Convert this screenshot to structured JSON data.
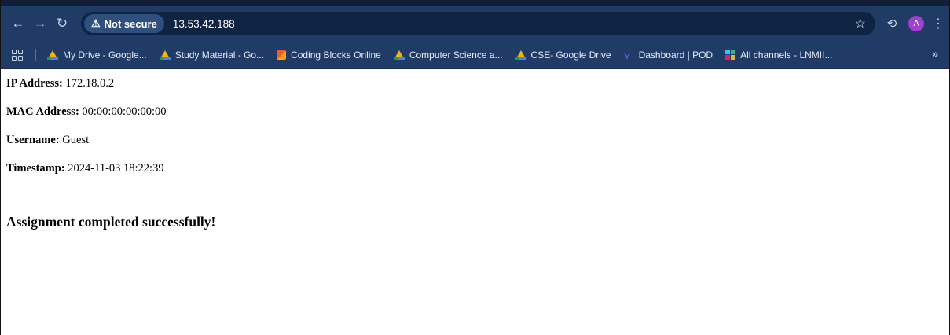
{
  "browser": {
    "security_label": "Not secure",
    "url": "13.53.42.188",
    "profile_initial": "A"
  },
  "bookmarks": [
    {
      "label": "My Drive - Google...",
      "icon": "google-drive-icon"
    },
    {
      "label": "Study Material - Go...",
      "icon": "google-drive-icon"
    },
    {
      "label": "Coding Blocks Online",
      "icon": "coding-blocks-icon"
    },
    {
      "label": "Computer Science a...",
      "icon": "google-drive-icon"
    },
    {
      "label": "CSE- Google Drive",
      "icon": "google-drive-icon"
    },
    {
      "label": "Dashboard | POD",
      "icon": "pod-icon"
    },
    {
      "label": "All channels - LNMII...",
      "icon": "slack-icon"
    }
  ],
  "info": {
    "ip_label": "IP Address:",
    "ip_value": " 172.18.0.2",
    "mac_label": "MAC Address:",
    "mac_value": " 00:00:00:00:00:00",
    "username_label": "Username:",
    "username_value": " Guest",
    "timestamp_label": "Timestamp:",
    "timestamp_value": " 2024-11-03 18:22:39"
  },
  "message": "Assignment completed successfully!",
  "colors": {
    "toolbar_bg": "#1f3b66",
    "omnibox_bg": "#0f2342",
    "avatar_bg": "#a23fcf"
  }
}
